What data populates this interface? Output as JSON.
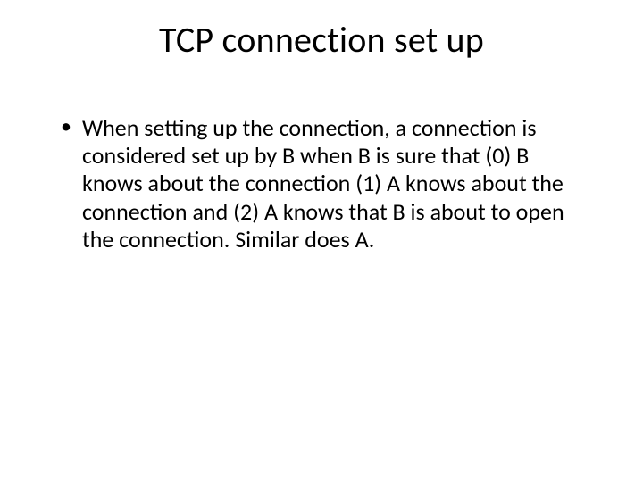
{
  "slide": {
    "title": "TCP connection set up",
    "bullets": [
      "When setting up the connection, a connection is considered set up by B when B is sure that (0) B knows about the connection (1) A knows about the connection and (2) A knows that B is about to open the connection. Similar does A."
    ]
  }
}
